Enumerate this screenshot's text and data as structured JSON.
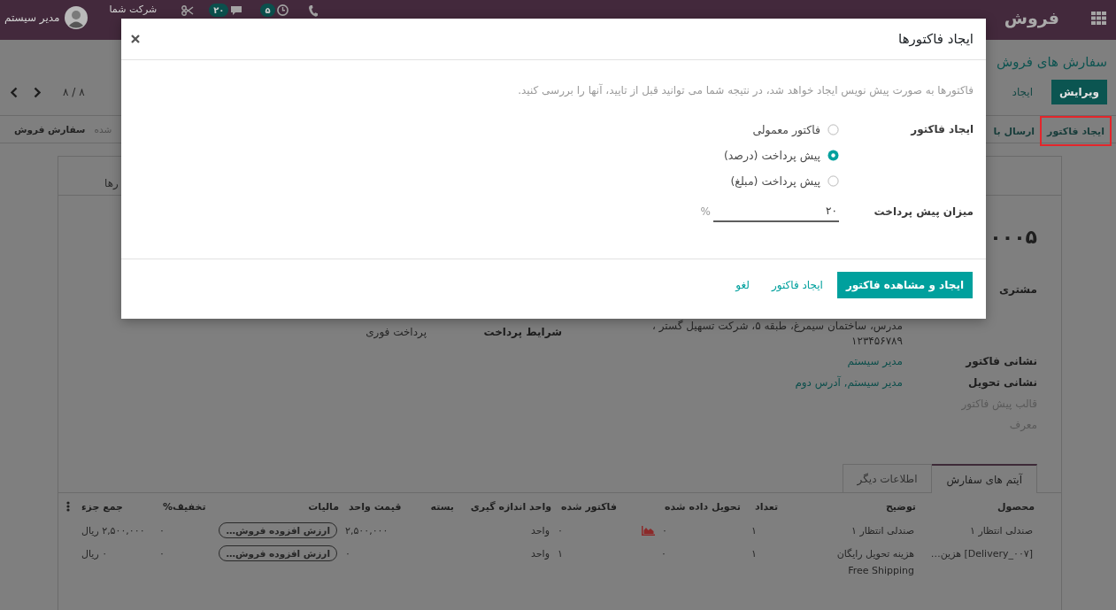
{
  "topbar": {
    "app_name": "فروش",
    "activity_count": "۵",
    "chat_count": "۲۰",
    "company": "شرکت شما",
    "user_name": "مدیر سیستم"
  },
  "control_panel": {
    "breadcrumb": "سفارش های فروش",
    "buttons": [
      {
        "label": "ویرایش",
        "kind": "primary"
      },
      {
        "label": "ایجاد",
        "kind": "secondary"
      }
    ],
    "pager": "۸ / ۸"
  },
  "header": {
    "buttons": [
      {
        "label": "ایجاد فاکتور",
        "highlighted": true
      },
      {
        "label": "ارسال با",
        "highlighted": false
      }
    ],
    "statusbar": [
      {
        "label": "شده",
        "selected": false
      },
      {
        "label": "سفارش فروش",
        "selected": true
      }
    ]
  },
  "form": {
    "smart_button": "رها",
    "order_name": "۰۰۰۵",
    "right_fields": [
      {
        "kind": "address",
        "label": "مشتری",
        "lines": [
          "مدرس، ساختمان سیمرغ، طبقه ۵، شرکت تسهیل گستر ،",
          "۱۲۳۴۵۶۷۸۹"
        ]
      },
      {
        "kind": "link",
        "label": "نشانی فاکتور",
        "value": "مدیر سیستم"
      },
      {
        "kind": "link",
        "label": "نشانی تحویل",
        "value": "مدیر سیستم, آدرس دوم"
      },
      {
        "kind": "empty",
        "label": "قالب پیش فاکتور"
      },
      {
        "kind": "empty",
        "label": "معرف"
      }
    ],
    "left_fields": [
      {
        "kind": "text",
        "label": "شرایط پرداخت",
        "value": "پرداخت فوری"
      }
    ],
    "tabs": [
      {
        "label": "آیتم های سفارش",
        "selected": true
      },
      {
        "label": "اطلاعات دیگر",
        "selected": false
      }
    ]
  },
  "order_lines": {
    "columns": [
      "محصول",
      "توضیح",
      "تعداد",
      "تحویل داده شده",
      "فاکتور شده",
      "واحد اندازه گیری",
      "بسته",
      "قیمت واحد",
      "مالیات",
      "تخفیف%",
      "جمع جزء"
    ],
    "rows": [
      {
        "product": "صندلی انتظار ۱",
        "description": "صندلی انتظار ۱",
        "quantity": "۱",
        "delivered": "۰",
        "stock_warning": true,
        "invoiced": "۰",
        "uom": "واحد",
        "unit_price": "۲,۵۰۰,۰۰۰",
        "taxes": "ارزش افزوده فروش…",
        "discount": "۰",
        "subtotal": "۲,۵۰۰,۰۰۰ ریال"
      },
      {
        "product": "[Delivery_۰۰۷] هزین…",
        "description": "هزینه تحویل رایگان\nFree Shipping",
        "quantity": "۱",
        "delivered": "۰",
        "stock_warning": false,
        "invoiced": "۱",
        "uom": "واحد",
        "unit_price": "۰",
        "taxes": "ارزش افزوده فروش…",
        "discount": "۰",
        "subtotal": "۰ ریال"
      }
    ]
  },
  "dialog": {
    "title": "ایجاد فاکتورها",
    "description": "فاکتورها به صورت پیش نویس ایجاد خواهد شد، در نتیجه شما می توانید قبل از تایید، آنها را بررسی کنید.",
    "method_label": "ایجاد فاکتور",
    "options": [
      {
        "label": "فاکتور معمولی",
        "selected": false
      },
      {
        "label": "پیش پرداخت (درصد)",
        "selected": true
      },
      {
        "label": "پیش پرداخت (مبلغ)",
        "selected": false
      }
    ],
    "amount_label": "میزان پیش پرداخت",
    "amount_value": "۲۰",
    "amount_unit": "%",
    "buttons": [
      {
        "label": "ایجاد و مشاهده فاکتور",
        "kind": "primary"
      },
      {
        "label": "ایجاد فاکتور",
        "kind": "link"
      },
      {
        "label": "لغو",
        "kind": "link"
      }
    ]
  }
}
